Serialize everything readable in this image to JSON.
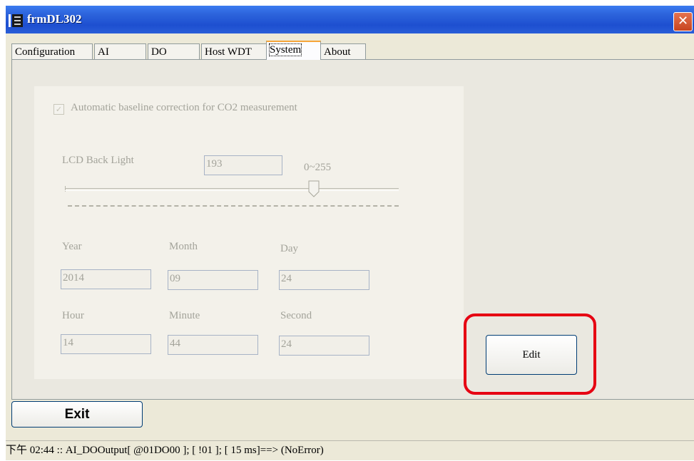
{
  "window": {
    "title": "frmDL302"
  },
  "tabs": [
    {
      "label": "Configuration"
    },
    {
      "label": "AI"
    },
    {
      "label": "DO"
    },
    {
      "label": "Host WDT"
    },
    {
      "label": "System"
    },
    {
      "label": "About"
    }
  ],
  "active_tab": "System",
  "system": {
    "co2_checkbox_label": "Automatic baseline correction for CO2 measurement",
    "co2_checked": true,
    "backlight_label": "LCD Back Light",
    "backlight_value": "193",
    "backlight_range": "0~255",
    "year_label": "Year",
    "year_value": "2014",
    "month_label": "Month",
    "month_value": "09",
    "day_label": "Day",
    "day_value": "24",
    "hour_label": "Hour",
    "hour_value": "14",
    "minute_label": "Minute",
    "minute_value": "44",
    "second_label": "Second",
    "second_value": "24",
    "edit_label": "Edit"
  },
  "exit_label": "Exit",
  "status_text": "下午 02:44 :: AI_DOOutput[ @01DO00 ]; [ !01 ]; [ 15 ms]==> (NoError)",
  "colors": {
    "title_bar": "#2d64dc",
    "highlight": "#e60012",
    "active_tab_accent": "#f6a63a"
  }
}
